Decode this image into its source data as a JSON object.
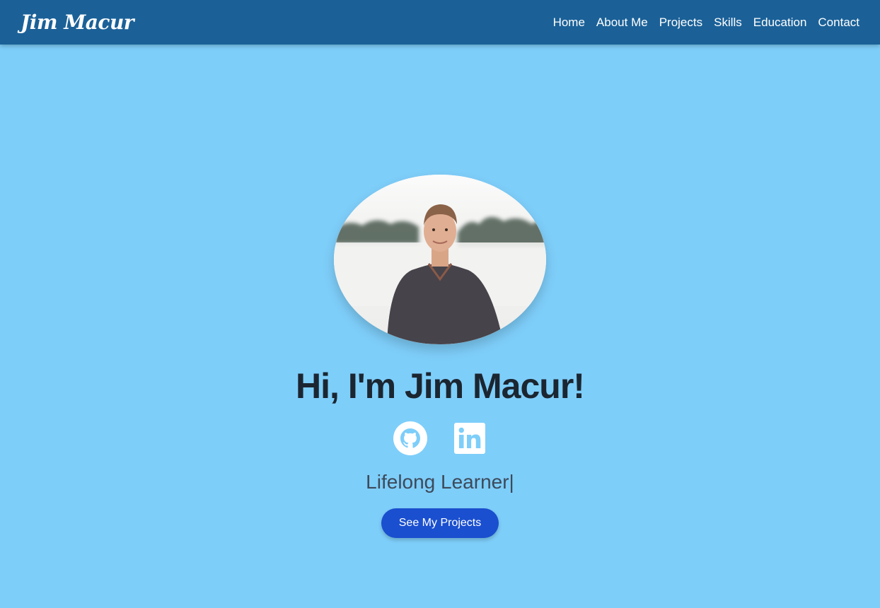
{
  "navbar": {
    "brand": "Jim Macur",
    "links": [
      {
        "label": "Home"
      },
      {
        "label": "About Me"
      },
      {
        "label": "Projects"
      },
      {
        "label": "Skills"
      },
      {
        "label": "Education"
      },
      {
        "label": "Contact"
      }
    ]
  },
  "hero": {
    "avatar_icon": "profile-photo",
    "greeting": "Hi, I'm Jim Macur!",
    "socials": [
      {
        "icon": "github-icon"
      },
      {
        "icon": "linkedin-icon"
      }
    ],
    "tagline": "Lifelong Learner|",
    "cta_label": "See My Projects"
  },
  "colors": {
    "navbar_bg": "#1b6198",
    "page_bg": "#7ecefa",
    "cta_bg": "#1a4fcf",
    "heading": "#1b2631"
  }
}
